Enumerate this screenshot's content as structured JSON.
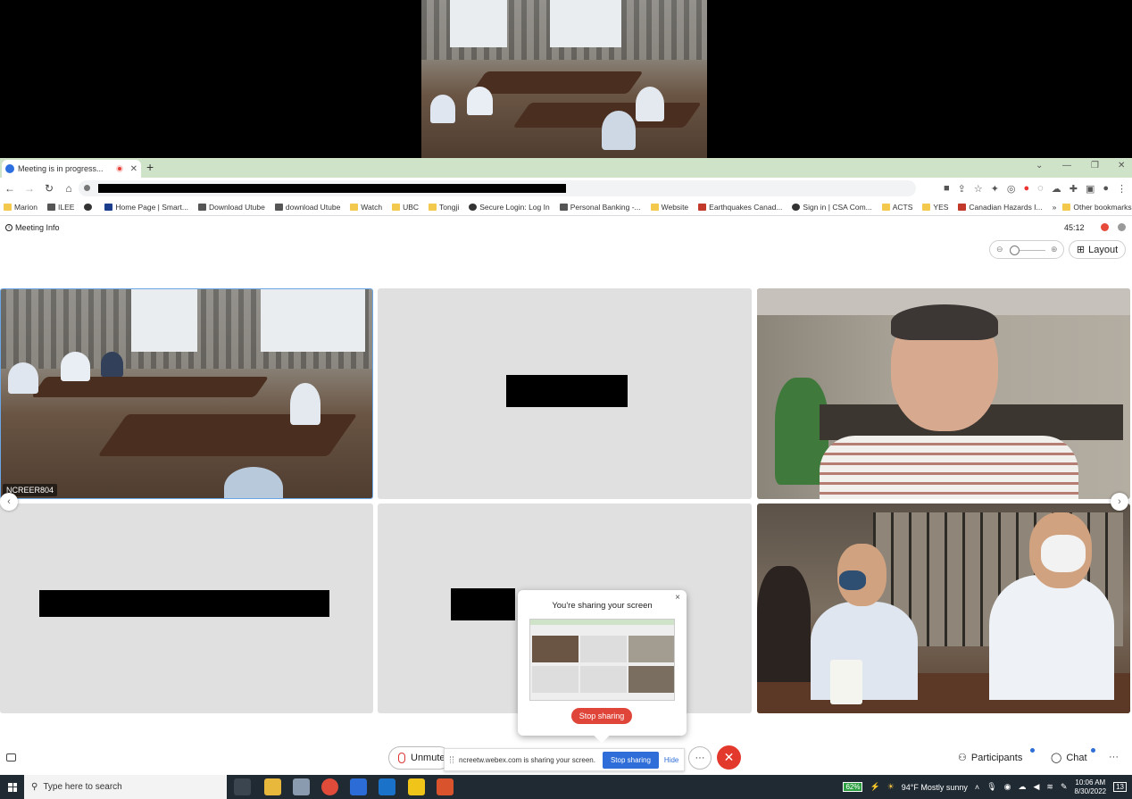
{
  "browser": {
    "tab_title": "Meeting is in progress...",
    "bookmarks": [
      {
        "label": "Marion",
        "icon": "folder-icon"
      },
      {
        "label": "ILEE",
        "icon": "doc-icon"
      },
      {
        "label": "",
        "icon": "globe-icon"
      },
      {
        "label": "Home Page | Smart...",
        "icon": "site-icon"
      },
      {
        "label": "Download Utube",
        "icon": "download-icon"
      },
      {
        "label": "download Utube",
        "icon": "download-icon"
      },
      {
        "label": "Watch",
        "icon": "folder-icon"
      },
      {
        "label": "UBC",
        "icon": "folder-icon"
      },
      {
        "label": "Tongji",
        "icon": "folder-icon"
      },
      {
        "label": "Secure Login: Log In",
        "icon": "globe-icon"
      },
      {
        "label": "Personal Banking -...",
        "icon": "doc-icon"
      },
      {
        "label": "Website",
        "icon": "folder-icon"
      },
      {
        "label": "Earthquakes Canad...",
        "icon": "maple-leaf-icon"
      },
      {
        "label": "Sign in | CSA Com...",
        "icon": "globe-icon"
      },
      {
        "label": "ACTS",
        "icon": "folder-icon"
      },
      {
        "label": "YES",
        "icon": "folder-icon"
      },
      {
        "label": "Canadian Hazards I...",
        "icon": "maple-leaf-icon"
      },
      {
        "label": "»",
        "icon": ""
      },
      {
        "label": "Other bookmarks",
        "icon": "folder-icon"
      }
    ]
  },
  "meeting": {
    "info_label": "Meeting Info",
    "timer": "45:12",
    "layout_label": "Layout",
    "participant_label": "NCREER804",
    "share_popup": {
      "title": "You're sharing your screen",
      "stop_label": "Stop sharing",
      "close": "×"
    },
    "sharing_bar": {
      "text": "ncreetw.webex.com is sharing your screen.",
      "stop_label": "Stop sharing",
      "hide_label": "Hide"
    },
    "controls": {
      "unmute_label": "Unmute",
      "more_label": "···",
      "end_label": "✕",
      "participants_label": "Participants",
      "chat_label": "Chat",
      "menu_label": "···"
    }
  },
  "taskbar": {
    "search_placeholder": "Type here to search",
    "battery": "62%",
    "weather": "94°F  Mostly sunny",
    "time": "10:06 AM",
    "date": "8/30/2022",
    "notif_count": "13"
  },
  "colors": {
    "end_call": "#e3382c",
    "stop_share": "#e0453a",
    "accent_blue": "#2f6ed8",
    "tab_strip": "#cfe3c8"
  }
}
